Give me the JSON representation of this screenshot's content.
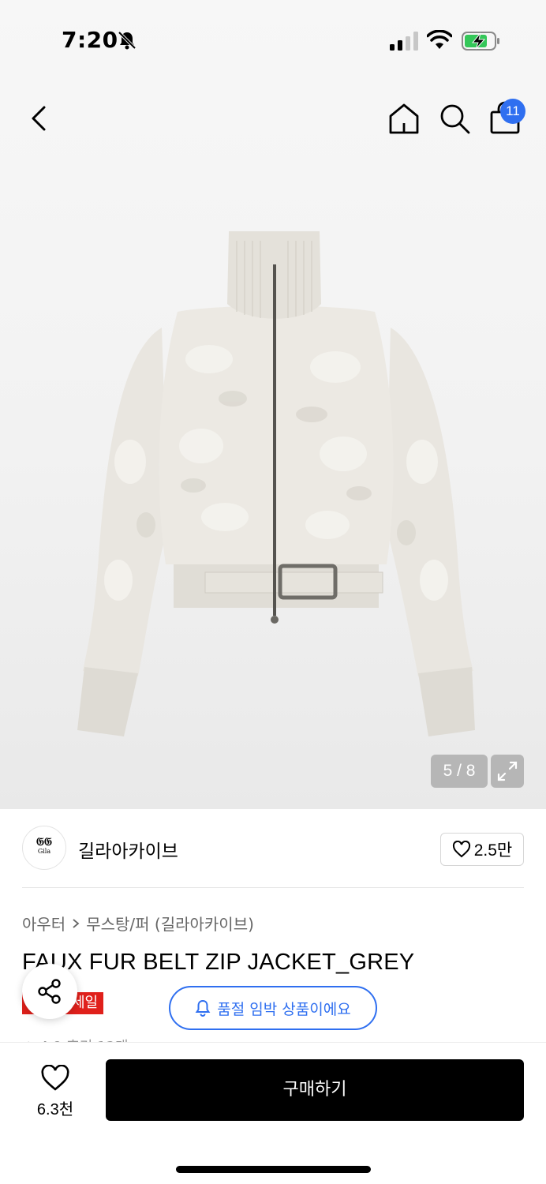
{
  "status_bar": {
    "time": "7:20"
  },
  "nav": {
    "cart_count": "11"
  },
  "gallery": {
    "page_indicator": "5 / 8"
  },
  "brand": {
    "logo_mark": "𝔊𝔊",
    "logo_text": "Gila",
    "name": "길라아카이브",
    "like_count": "2.5만"
  },
  "breadcrumb": {
    "category": "아우터",
    "subcategory": "무스탕/퍼 (길라아카이브)"
  },
  "product": {
    "title": "FAUX FUR BELT ZIP JACKET_GREY",
    "sale_badge": "세일",
    "rating_peek": "★ 4.9 후기 12개"
  },
  "notice": {
    "soldout_text": "품절 임박 상품이에요"
  },
  "bottom": {
    "wish_count": "6.3천",
    "buy_label": "구매하기"
  },
  "colors": {
    "accent": "#2f6ff0",
    "sale": "#e0201b",
    "buy_button": "#000000"
  }
}
